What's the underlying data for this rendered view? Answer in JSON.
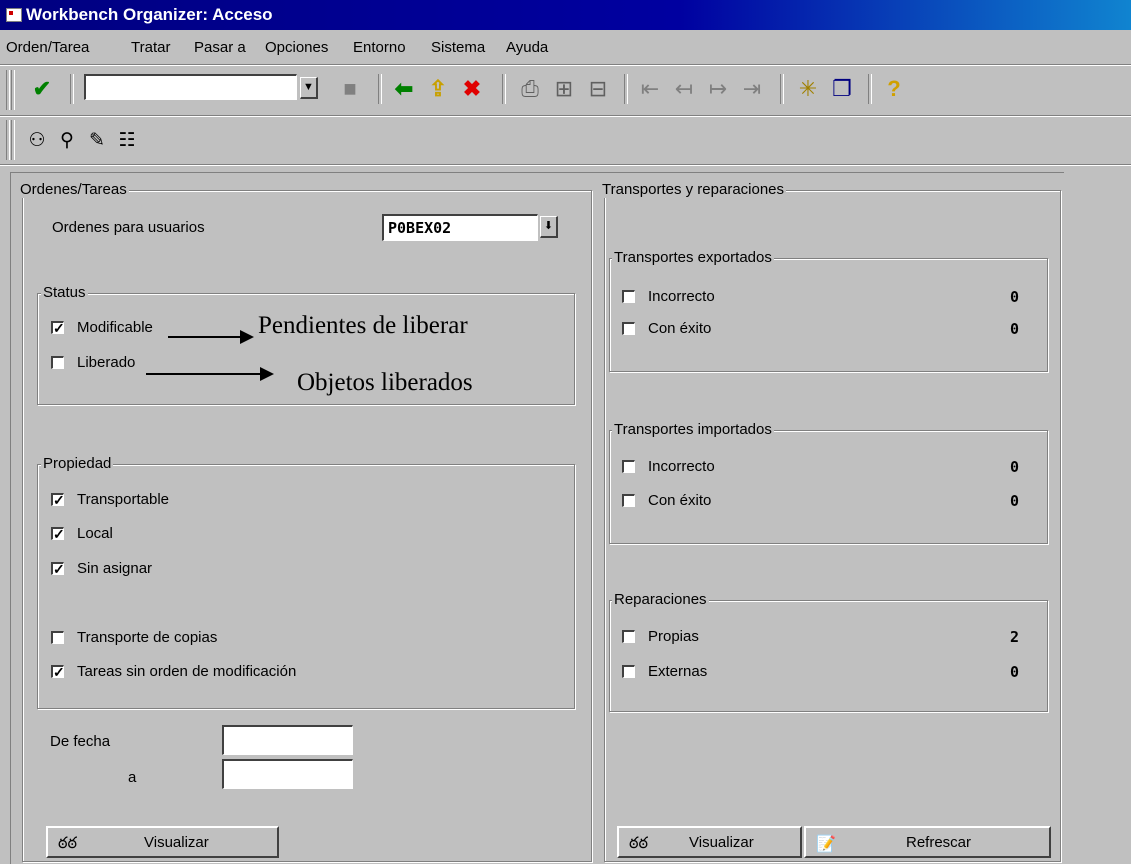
{
  "window": {
    "title": "Workbench Organizer: Acceso"
  },
  "menu": [
    {
      "label": "Orden/Tarea"
    },
    {
      "label": "Tratar"
    },
    {
      "label": "Pasar a"
    },
    {
      "label": "Opciones"
    },
    {
      "label": "Entorno"
    },
    {
      "label": "Sistema"
    },
    {
      "label": "Ayuda"
    }
  ],
  "toolbar": {
    "command_value": "",
    "icons": [
      "check-icon",
      "save-icon",
      "back-icon",
      "exit-icon",
      "cancel-icon",
      "print-icon",
      "find-icon",
      "find-next-icon",
      "first-page-icon",
      "previous-page-icon",
      "next-page-icon",
      "last-page-icon",
      "new-session-icon",
      "create-shortcut-icon",
      "help-icon"
    ]
  },
  "app_toolbar": {
    "icons": [
      "binoculars-icon",
      "magnifier-icon",
      "display-change-icon",
      "hierarchy-icon"
    ]
  },
  "left": {
    "group_title": "Ordenes/Tareas",
    "users_label": "Ordenes para usuarios",
    "users_value": "P0BEX02",
    "status": {
      "title": "Status",
      "items": [
        {
          "label": "Modificable",
          "checked": true
        },
        {
          "label": "Liberado",
          "checked": false
        }
      ]
    },
    "propiedad": {
      "title": "Propiedad",
      "items": [
        {
          "label": "Transportable",
          "checked": true
        },
        {
          "label": "Local",
          "checked": true
        },
        {
          "label": "Sin asignar",
          "checked": true
        },
        {
          "label": "Transporte de copias",
          "checked": false
        },
        {
          "label": "Tareas sin orden de modificación",
          "checked": true
        }
      ]
    },
    "date_from_label": "De fecha",
    "date_to_label": "a",
    "date_from_value": "",
    "date_to_value": "",
    "display_button": "Visualizar"
  },
  "right": {
    "group_title": "Transportes y reparaciones",
    "exported": {
      "title": "Transportes exportados",
      "items": [
        {
          "label": "Incorrecto",
          "count": "0"
        },
        {
          "label": "Con éxito",
          "count": "0"
        }
      ]
    },
    "imported": {
      "title": "Transportes importados",
      "items": [
        {
          "label": "Incorrecto",
          "count": "0"
        },
        {
          "label": "Con éxito",
          "count": "0"
        }
      ]
    },
    "repairs": {
      "title": "Reparaciones",
      "items": [
        {
          "label": "Propias",
          "count": "2"
        },
        {
          "label": "Externas",
          "count": "0"
        }
      ]
    },
    "display_button": "Visualizar",
    "refresh_button": "Refrescar"
  },
  "annotations": {
    "pending": "Pendientes de liberar",
    "released": "Objetos liberados"
  }
}
